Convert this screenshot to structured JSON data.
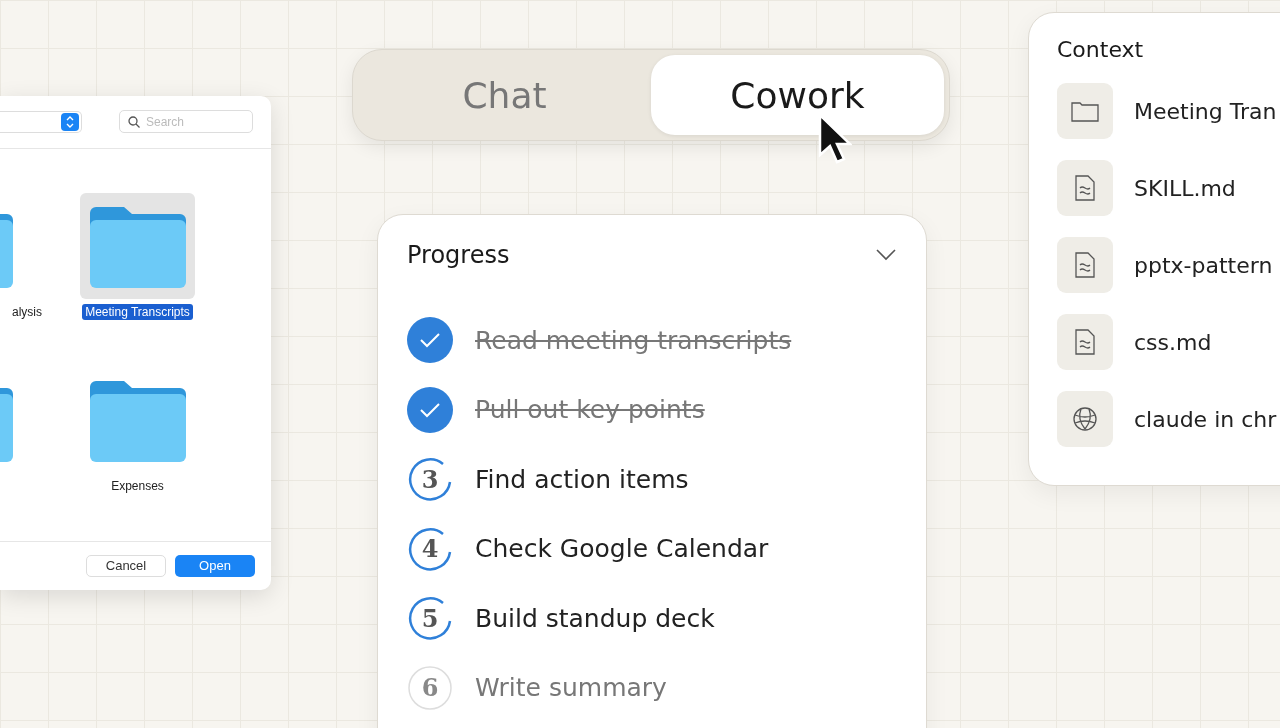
{
  "file_dialog": {
    "search": {
      "placeholder": "Search"
    },
    "folders": [
      {
        "label": "alysis",
        "selected": false
      },
      {
        "label": "Meeting Transcripts",
        "selected": true
      },
      {
        "selected": false
      },
      {
        "label": "Expenses",
        "selected": false
      }
    ],
    "buttons": [
      {
        "label": "Cancel",
        "kind": "secondary"
      },
      {
        "label": "Open",
        "kind": "primary"
      }
    ]
  },
  "mode_switch": {
    "tabs": [
      {
        "label": "Chat",
        "selected": false
      },
      {
        "label": "Cowork",
        "selected": true
      }
    ]
  },
  "progress": {
    "title": "Progress",
    "expanded": true,
    "steps": [
      {
        "label": "Read meeting transcripts",
        "done": true
      },
      {
        "label": "Pull out key points",
        "done": true
      },
      {
        "number": "3",
        "label": "Find action items",
        "done": false,
        "active": true
      },
      {
        "number": "4",
        "label": "Check Google Calendar",
        "done": false,
        "active": true
      },
      {
        "number": "5",
        "label": "Build standup deck",
        "done": false,
        "active": true
      },
      {
        "number": "6",
        "label": "Write summary",
        "done": false,
        "active": false
      }
    ]
  },
  "context": {
    "title": "Context",
    "items": [
      {
        "kind": "folder",
        "label": "Meeting Tran"
      },
      {
        "kind": "file",
        "label": "SKILL.md"
      },
      {
        "kind": "file",
        "label": "pptx-pattern"
      },
      {
        "kind": "file",
        "label": "css.md"
      },
      {
        "kind": "globe",
        "label": "claude in chr"
      }
    ]
  }
}
